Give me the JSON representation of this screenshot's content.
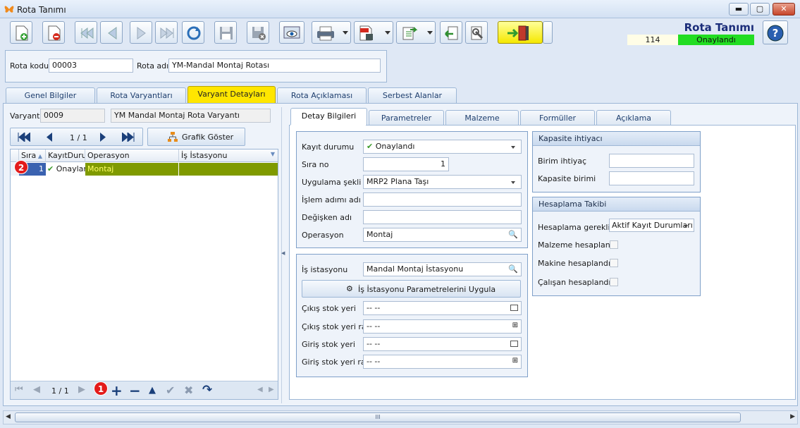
{
  "window": {
    "title": "Rota Tanımı",
    "min": "▬",
    "max": "▢",
    "close": "✕"
  },
  "header": {
    "title": "Rota Tanımı",
    "record_no": "114",
    "status": "Onaylandı",
    "status_color": "#22dd22"
  },
  "toolbar": {
    "icons": [
      "new-doc-icon",
      "delete-doc-icon",
      "first-icon",
      "prev-icon",
      "next-icon",
      "last-icon",
      "refresh-icon",
      "save-icon",
      "save-close-icon",
      "preview-icon",
      "print-icon",
      "pdf-icon",
      "export-icon",
      "import-icon",
      "tools-icon",
      "exit-icon",
      "help-icon"
    ]
  },
  "form": {
    "rota_kodu_label": "Rota kodu",
    "rota_kodu": "00003",
    "rota_adi_label": "Rota adı",
    "rota_adi": "YM-Mandal Montaj Rotası"
  },
  "main_tabs": [
    "Genel Bilgiler",
    "Rota Varyantları",
    "Varyant Detayları",
    "Rota Açıklaması",
    "Serbest Alanlar"
  ],
  "variant": {
    "label": "Varyant",
    "code": "0009",
    "name": "YM Mandal Montaj Rota Varyantı"
  },
  "nav": {
    "page": "1 / 1",
    "graph_button": "Grafik Göster"
  },
  "grid": {
    "columns": [
      "Sıra",
      "KayıtDurumu",
      "Operasyon",
      "İş İstasyonu"
    ],
    "rows": [
      {
        "sira": "1",
        "durum": "Onaylandı",
        "operasyon": "Montaj",
        "istasyon": "Mandal Montaj İstasyonu"
      }
    ],
    "footer_page": "1 / 1"
  },
  "badges": {
    "one": "1",
    "two": "2"
  },
  "detail_tabs": [
    "Detay Bilgileri",
    "Parametreler",
    "Malzeme",
    "Formüller",
    "Açıklama"
  ],
  "detail": {
    "kayit_durumu_label": "Kayıt durumu",
    "kayit_durumu": "Onaylandı",
    "sira_no_label": "Sıra no",
    "sira_no": "1",
    "uygulama_label": "Uygulama şekli",
    "uygulama": "MRP2 Plana Taşı",
    "islem_label": "İşlem adımı adı",
    "islem": "",
    "degisken_label": "Değişken adı",
    "degisken": "",
    "operasyon_label": "Operasyon",
    "operasyon": "Montaj",
    "is_istasyonu_label": "İş istasyonu",
    "is_istasyonu": "Mandal Montaj İstasyonu",
    "apply_button": "İş İstasyonu Parametrelerini Uygula",
    "cikis_stok_label": "Çıkış stok yeri",
    "cikis_stok": "-- --",
    "cikis_raf_label": "Çıkış stok yeri raf",
    "cikis_raf": "-- --",
    "giris_stok_label": "Giriş stok yeri",
    "giris_stok": "-- --",
    "giris_raf_label": "Giriş stok yeri raf",
    "giris_raf": "-- --"
  },
  "kapasite": {
    "title": "Kapasite ihtiyacı",
    "birim_ihtiyac_label": "Birim ihtiyaç",
    "birim_ihtiyac": "",
    "kapasite_birimi_label": "Kapasite birimi",
    "kapasite_birimi": ""
  },
  "hesaplama": {
    "title": "Hesaplama Takibi",
    "gerekli_label": "Hesaplama gerekli",
    "gerekli": "Aktif Kayıt Durumları",
    "malzeme_label": "Malzeme hesaplandı",
    "makine_label": "Makine hesaplandı",
    "calisan_label": "Çalışan hesaplandı"
  },
  "scroll_grip": "III"
}
